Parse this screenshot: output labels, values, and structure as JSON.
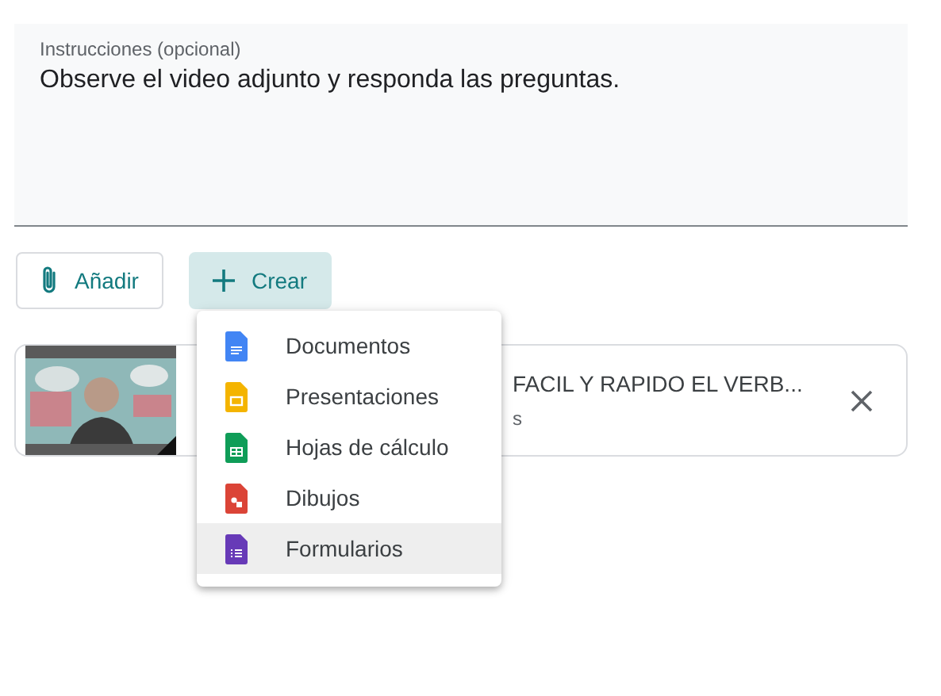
{
  "instructions": {
    "label": "Instrucciones (opcional)",
    "value": "Observe el video adjunto y responda las preguntas."
  },
  "buttons": [
    {
      "label": "Añadir",
      "kind": "attach",
      "expanded": false
    },
    {
      "label": "Crear",
      "kind": "create",
      "expanded": true
    }
  ],
  "attachment": {
    "kind": "picture",
    "title": "FACIL Y RAPIDO EL VERB...",
    "subtitle": "s"
  },
  "create_menu": [
    {
      "label": "Documentos",
      "kind": "docs",
      "selected": false
    },
    {
      "label": "Presentaciones",
      "kind": "slides",
      "selected": false
    },
    {
      "label": "Hojas de cálculo",
      "kind": "sheets",
      "selected": false
    },
    {
      "label": "Dibujos",
      "kind": "drawings",
      "selected": false
    },
    {
      "label": "Formularios",
      "kind": "forms",
      "selected": true
    }
  ]
}
